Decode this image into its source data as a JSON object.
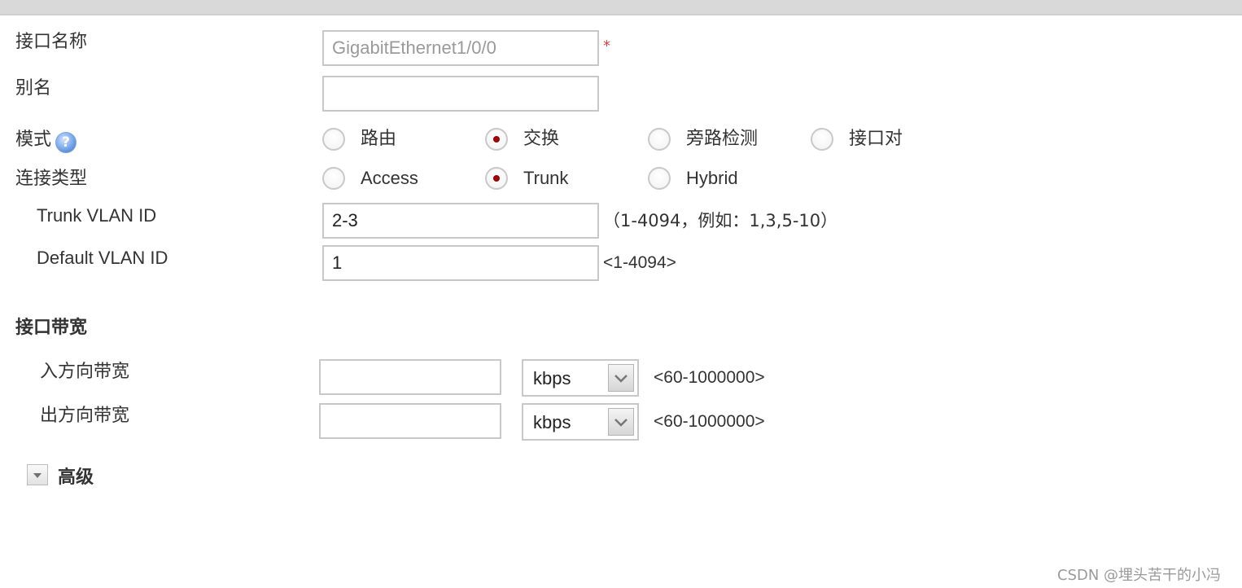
{
  "form": {
    "interface_name": {
      "label": "接口名称",
      "value": "GigabitEthernet1/0/0",
      "required_mark": "*"
    },
    "alias": {
      "label": "别名",
      "value": ""
    },
    "mode": {
      "label": "模式",
      "help_icon": "question-help-icon",
      "help_glyph": "?",
      "options": [
        "路由",
        "交换",
        "旁路检测",
        "接口对"
      ],
      "selected": "交换"
    },
    "link_type": {
      "label": "连接类型",
      "options": [
        "Access",
        "Trunk",
        "Hybrid"
      ],
      "selected": "Trunk"
    },
    "trunk_vlan": {
      "label": "Trunk VLAN ID",
      "value": "2-3",
      "hint": "（1-4094，例如：1,3,5-10）"
    },
    "default_vlan": {
      "label": "Default VLAN ID",
      "value": "1",
      "hint": "<1-4094>"
    }
  },
  "bandwidth": {
    "title": "接口带宽",
    "inbound": {
      "label": "入方向带宽",
      "value": "",
      "unit": "kbps",
      "hint": "<60-1000000>"
    },
    "outbound": {
      "label": "出方向带宽",
      "value": "",
      "unit": "kbps",
      "hint": "<60-1000000>"
    }
  },
  "advanced": {
    "label": "高级",
    "icon": "expand-down-icon"
  },
  "watermark": "CSDN @埋头苦干的小冯",
  "colors": {
    "radio_dot": "#a00000",
    "required": "#e04040",
    "top_bar": "#d9d9d9"
  }
}
